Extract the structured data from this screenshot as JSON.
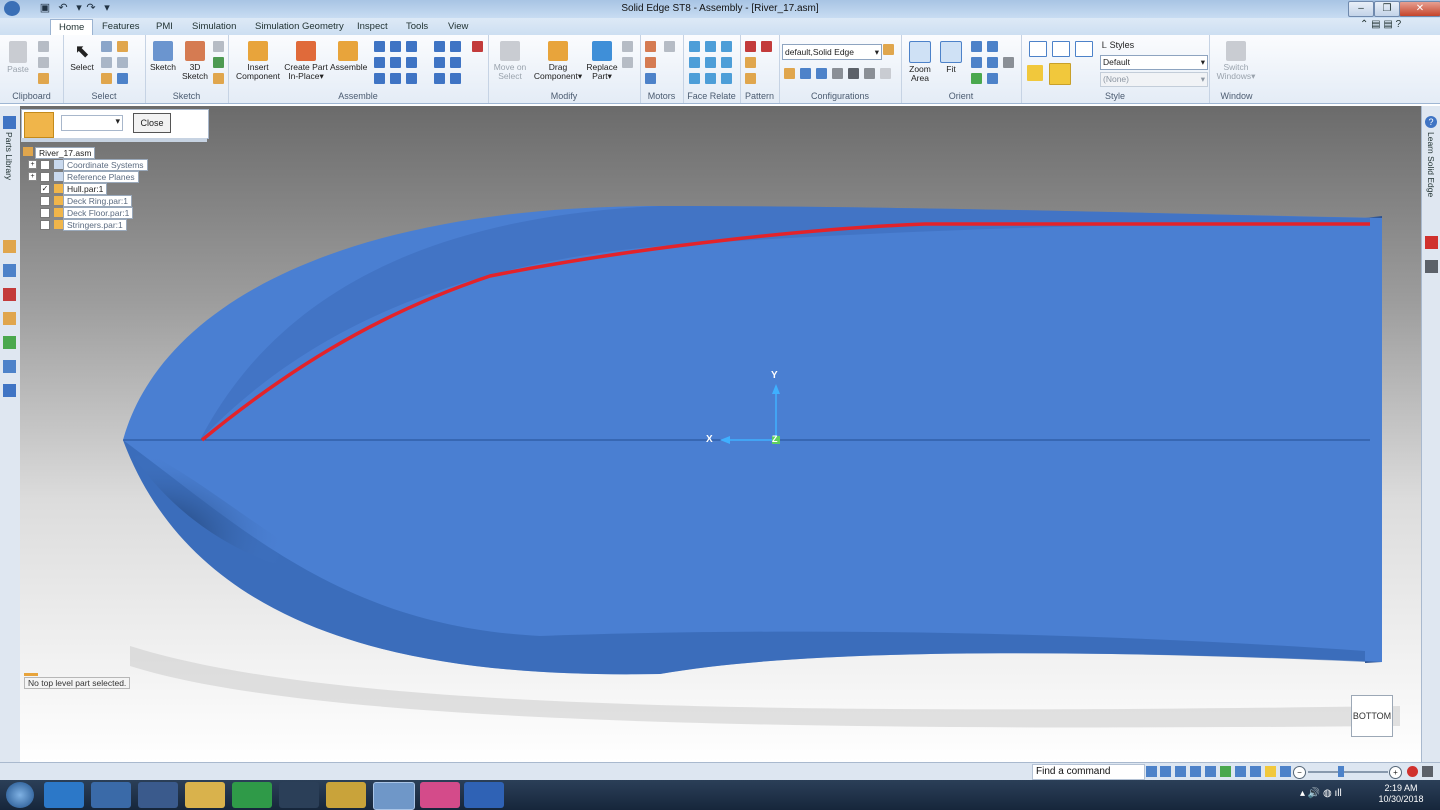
{
  "window": {
    "title": "Solid Edge ST8 - Assembly - [River_17.asm]"
  },
  "tabs": [
    "Home",
    "Features",
    "PMI",
    "Simulation",
    "Simulation Geometry",
    "Inspect",
    "Tools",
    "View"
  ],
  "ribbon": {
    "groups": [
      "Clipboard",
      "Select",
      "Sketch",
      "Assemble",
      "Modify",
      "Motors",
      "Face Relate",
      "Pattern",
      "Configurations",
      "Orient",
      "Style",
      "Window"
    ],
    "buttons": {
      "paste": "Paste",
      "select": "Select",
      "sketch": "Sketch",
      "sketch3d_l1": "3D",
      "sketch3d_l2": "Sketch",
      "insert_l1": "Insert",
      "insert_l2": "Component",
      "create_l1": "Create Part",
      "create_l2": "In-Place",
      "assemble": "Assemble",
      "move_l1": "Move on",
      "move_l2": "Select",
      "drag_l1": "Drag",
      "drag_l2": "Component",
      "replace_l1": "Replace",
      "replace_l2": "Part",
      "zoom_l1": "Zoom",
      "zoom_l2": "Area",
      "fit": "Fit",
      "switch_l1": "Switch",
      "switch_l2": "Windows"
    },
    "config_value": "default,Solid Edge",
    "styles_label": "Styles",
    "style_value": "Default",
    "style_value2": "(None)"
  },
  "pathfinder": {
    "close_label": "Close",
    "root": "River_17.asm",
    "items": [
      {
        "label": "Coordinate Systems",
        "checked": false,
        "expandable": true
      },
      {
        "label": "Reference Planes",
        "checked": false,
        "expandable": true
      },
      {
        "label": "Hull.par:1",
        "checked": true,
        "expandable": false
      },
      {
        "label": "Deck Ring.par:1",
        "checked": false,
        "expandable": false
      },
      {
        "label": "Deck Floor.par:1",
        "checked": false,
        "expandable": false
      },
      {
        "label": "Stringers.par:1",
        "checked": false,
        "expandable": false
      }
    ]
  },
  "sidebars": {
    "left_label": "Parts Library",
    "right_label": "Learn Solid Edge"
  },
  "viewport": {
    "axis_y": "Y",
    "axis_x": "X",
    "axis_z": "Z",
    "status_message": "No top level part selected.",
    "view_cube_label": "BOTTOM",
    "colors": {
      "hull": "#4a7fd2",
      "hull_dark": "#2d5290",
      "curve": "#e3232a"
    }
  },
  "command_bar": {
    "find_label": "Find a command"
  },
  "taskbar": {
    "time": "2:19 AM",
    "date": "10/30/2018"
  }
}
